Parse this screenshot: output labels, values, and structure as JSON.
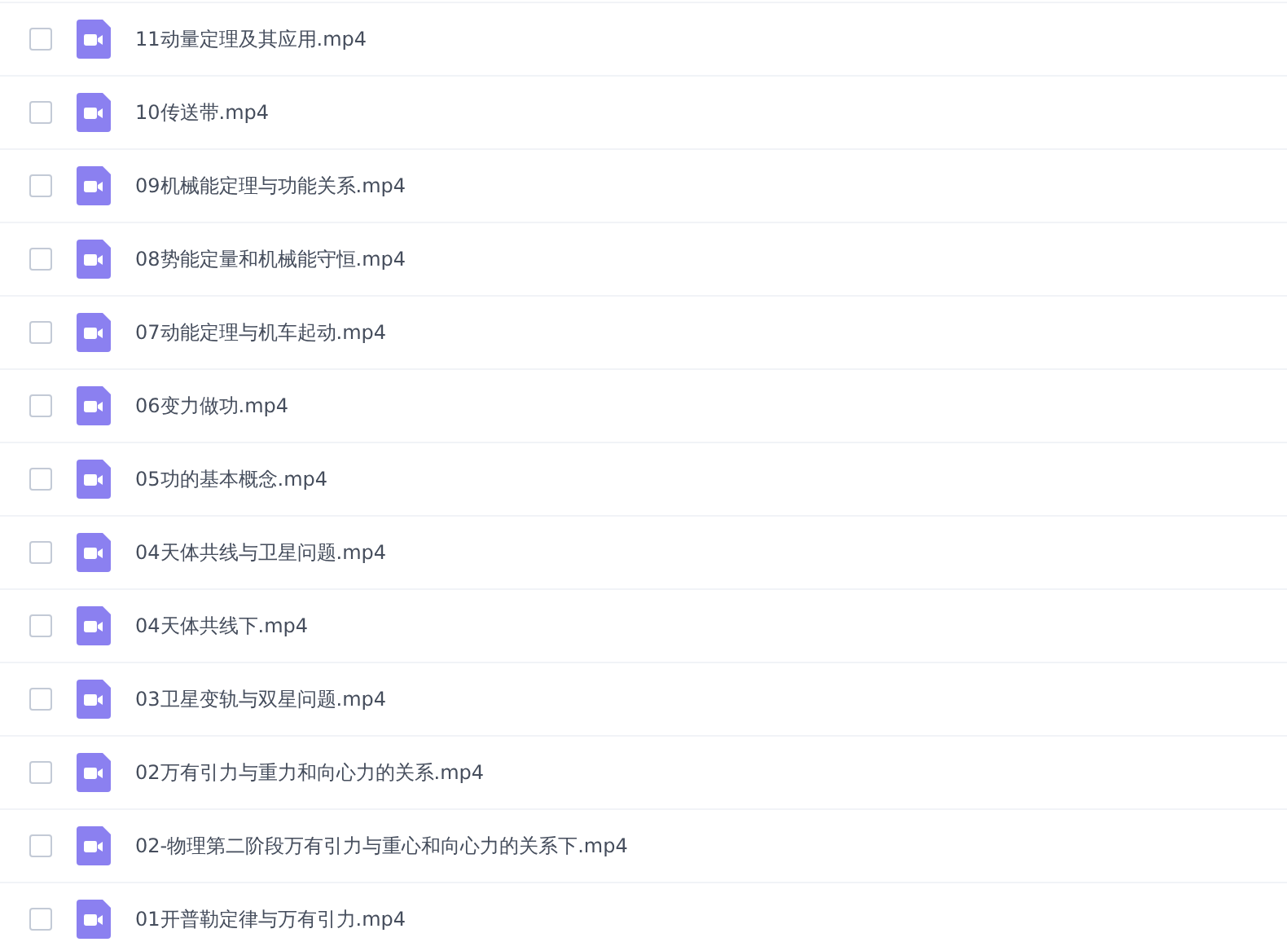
{
  "files": [
    {
      "name": "11动量定理及其应用.mp4",
      "checked": false
    },
    {
      "name": "10传送带.mp4",
      "checked": false
    },
    {
      "name": "09机械能定理与功能关系.mp4",
      "checked": false
    },
    {
      "name": "08势能定量和机械能守恒.mp4",
      "checked": false
    },
    {
      "name": "07动能定理与机车起动.mp4",
      "checked": false
    },
    {
      "name": "06变力做功.mp4",
      "checked": false
    },
    {
      "name": "05功的基本概念.mp4",
      "checked": false
    },
    {
      "name": "04天体共线与卫星问题.mp4",
      "checked": false
    },
    {
      "name": "04天体共线下.mp4",
      "checked": false
    },
    {
      "name": "03卫星变轨与双星问题.mp4",
      "checked": false
    },
    {
      "name": "02万有引力与重力和向心力的关系.mp4",
      "checked": false
    },
    {
      "name": "02-物理第二阶段万有引力与重心和向心力的关系下.mp4",
      "checked": false
    },
    {
      "name": "01开普勒定律与万有引力.mp4",
      "checked": false
    }
  ]
}
